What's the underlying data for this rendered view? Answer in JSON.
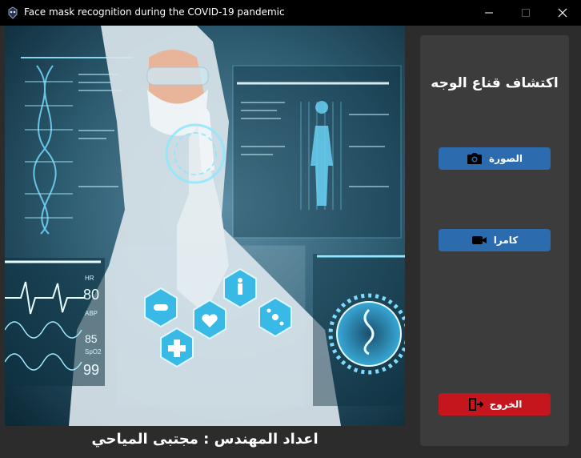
{
  "window": {
    "title": "Face mask recognition during the COVID-19 pandemic",
    "controls": [
      "minimize",
      "maximize",
      "close"
    ]
  },
  "hero": {
    "hud": {
      "hr": "HR",
      "hr_value": "80",
      "abp": "ABP",
      "abp_value": "85",
      "spo2": "SpO2",
      "spo2_value": "99"
    }
  },
  "credit": "اعداد المهندس : مجتبى المياحي",
  "panel": {
    "title": "اكتشاف قناع الوجه",
    "buttons": {
      "photo": {
        "label": "الصورة",
        "icon": "camera-icon"
      },
      "camera": {
        "label": "كامرا",
        "icon": "video-camera-icon"
      },
      "exit": {
        "label": "الخروج",
        "icon": "door-exit-icon"
      }
    }
  },
  "colors": {
    "panel": "#3c3c3c",
    "background": "#2c2c2c",
    "button_blue": "#2c6cae",
    "button_red": "#c4161c"
  }
}
